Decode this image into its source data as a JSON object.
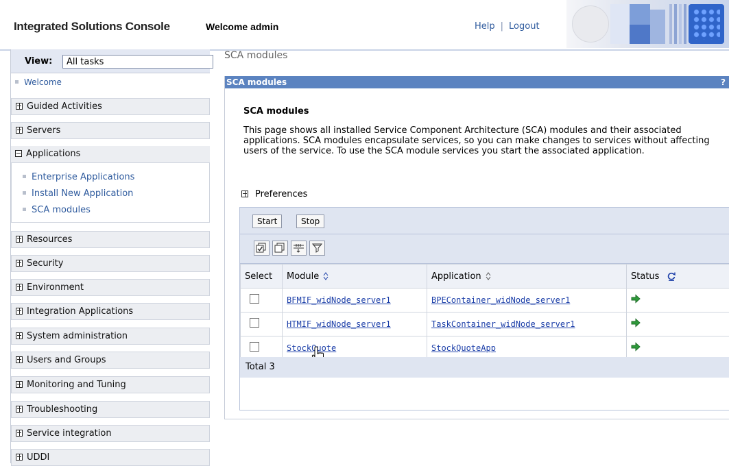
{
  "header": {
    "brand": "Integrated Solutions Console",
    "welcome": "Welcome admin",
    "help": "Help",
    "separator": "|",
    "logout": "Logout"
  },
  "nav": {
    "view_label": "View:",
    "view_value": "All tasks",
    "welcome": "Welcome",
    "sections": [
      {
        "label": "Guided Activities",
        "expanded": false
      },
      {
        "label": "Servers",
        "expanded": false
      },
      {
        "label": "Applications",
        "expanded": true
      },
      {
        "label": "Resources",
        "expanded": false
      },
      {
        "label": "Security",
        "expanded": false
      },
      {
        "label": "Environment",
        "expanded": false
      },
      {
        "label": "Integration Applications",
        "expanded": false
      },
      {
        "label": "System administration",
        "expanded": false
      },
      {
        "label": "Users and Groups",
        "expanded": false
      },
      {
        "label": "Monitoring and Tuning",
        "expanded": false
      },
      {
        "label": "Troubleshooting",
        "expanded": false
      },
      {
        "label": "Service integration",
        "expanded": false
      },
      {
        "label": "UDDI",
        "expanded": false
      }
    ],
    "applications_children": [
      "Enterprise Applications",
      "Install New Application",
      "SCA modules"
    ]
  },
  "main": {
    "breadcrumb": "SCA modules",
    "panel_title": "SCA modules",
    "panel_help": "?",
    "heading": "SCA modules",
    "description": "This page shows all installed Service Component Architecture (SCA) modules and their associated applications. SCA modules encapsulate services, so you can make changes to services without affecting users of the service. To use the SCA module services you start the associated application.",
    "preferences": "Preferences",
    "buttons": {
      "start": "Start",
      "stop": "Stop"
    },
    "toolbar_icons": [
      "select-all-icon",
      "deselect-all-icon",
      "expand-filter-icon",
      "filter-icon"
    ],
    "table": {
      "headers": [
        "Select",
        "Module",
        "Application",
        "Status"
      ],
      "rows": [
        {
          "module": "BFMIF_widNode_server1",
          "application": "BPEContainer_widNode_server1",
          "status": "started"
        },
        {
          "module": "HTMIF_widNode_server1",
          "application": "TaskContainer_widNode_server1",
          "status": "started"
        },
        {
          "module": "StockQuote",
          "application": "StockQuoteApp",
          "status": "started"
        }
      ],
      "total": "Total 3"
    }
  },
  "colors": {
    "panel_title_bg": "#5b83c0",
    "link": "#1b3ea8",
    "status_green": "#2e9a3a"
  }
}
